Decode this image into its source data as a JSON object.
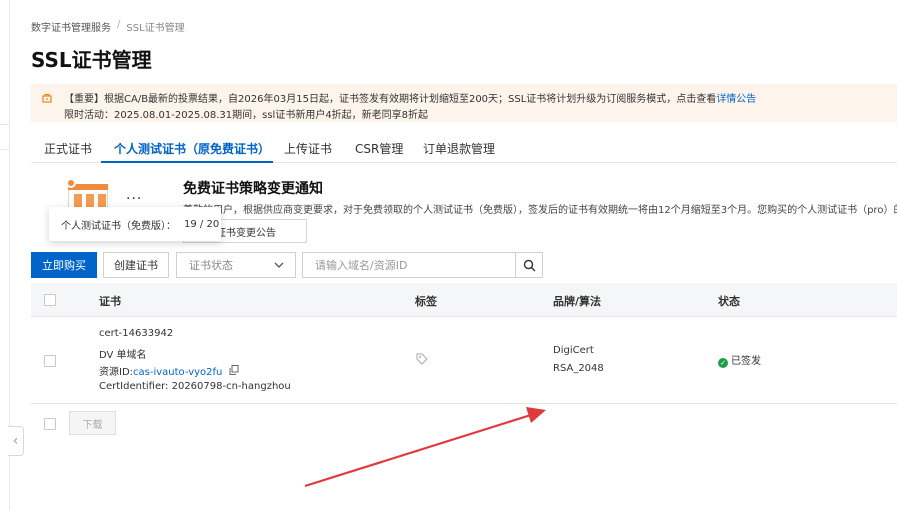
{
  "breadcrumb": {
    "root": "数字证书管理服务",
    "separator": "/",
    "current": "SSL证书管理"
  },
  "page_title": "SSL证书管理",
  "notice": {
    "line1_text": "【重要】根据CA/B最新的投票结果，自2026年03月15日起，证书签发有效期将计划缩短至200天；SSL证书将计划升级为订阅服务模式，点击查看",
    "line1_link": "详情公告",
    "line2_text": "限时活动：2025.08.01-2025.08.31期间，ssl证书新用户4折起，新老同享8折起"
  },
  "tabs": [
    {
      "label": "正式证书"
    },
    {
      "label": "个人测试证书（原免费证书）"
    },
    {
      "label": "上传证书"
    },
    {
      "label": "CSR管理"
    },
    {
      "label": "订单退款管理"
    }
  ],
  "promo": {
    "title": "免费证书策略变更通知",
    "desc": "尊敬的用户，根据供应商变更要求，对于免费领取的个人测试证书（免费版），签发后的证书有效期统一将由12个月缩短至3个月。您购买的个人测试证书（pro）的有效",
    "button": "免费证书变更公告",
    "more": "···"
  },
  "tooltip": {
    "label": "个人测试证书（免费版）：",
    "value": "19 / 20"
  },
  "toolbar": {
    "buy_label": "立即购买",
    "create_label": "创建证书",
    "status_placeholder": "证书状态",
    "search_placeholder": "请输入域名/资源ID"
  },
  "table": {
    "headers": [
      "证书",
      "标签",
      "品牌/算法",
      "状态"
    ],
    "rows": [
      {
        "name": "cert-14633942",
        "type": "DV 单域名",
        "resource_prefix": "资源ID:",
        "resource_id": "cas-ivauto-vyo2fu",
        "identifier": "CertIdentifier: 20260798-cn-hangzhou",
        "brand": "DigiCert",
        "algorithm": "RSA_2048",
        "status": "已签发"
      }
    ]
  },
  "footer": {
    "download_label": "下载"
  },
  "colors": {
    "accent": "#0064c8",
    "notice_bg": "#fdf5eb",
    "status_ok": "#1e9d4a",
    "annotation_arrow": "#e0393e"
  }
}
